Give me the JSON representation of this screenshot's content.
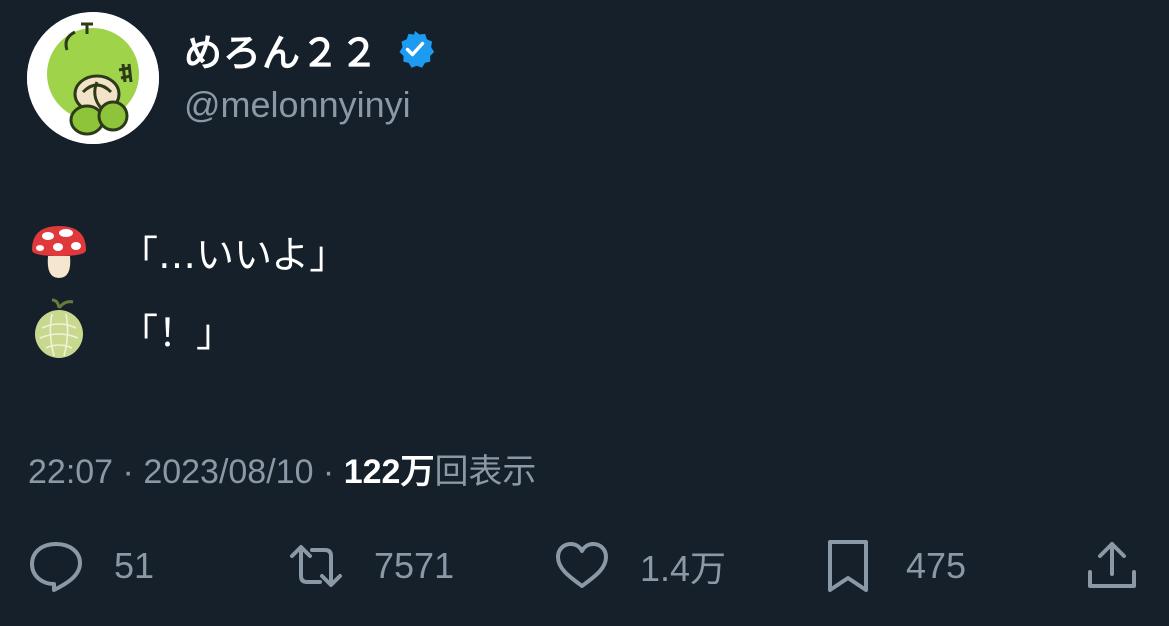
{
  "user": {
    "display_name": "めろん２２",
    "handle": "@melonnyinyi",
    "verified": true,
    "verified_color": "#1d9bf0"
  },
  "tweet": {
    "lines": [
      {
        "emoji": "mushroom-icon",
        "text": "「…いいよ」"
      },
      {
        "emoji": "melon-icon",
        "text": "「！」"
      }
    ]
  },
  "meta": {
    "time": "22:07",
    "separator": " · ",
    "date": "2023/08/10",
    "views_count": "122",
    "views_unit": "万",
    "views_label": "回表示"
  },
  "actions": {
    "replies": "51",
    "retweets": "7571",
    "likes": "1.4万",
    "bookmarks": "475"
  },
  "colors": {
    "background": "#15202b",
    "secondary_text": "#8b98a5",
    "primary_text": "#ffffff"
  }
}
